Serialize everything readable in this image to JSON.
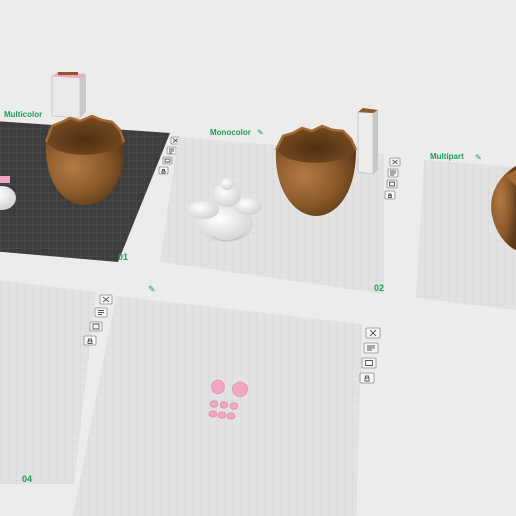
{
  "plates": [
    {
      "label": "Multicolor",
      "edit_icon": "pencil-icon",
      "number": "01",
      "active": true
    },
    {
      "label": "Monocolor",
      "edit_icon": "pencil-icon",
      "number": "02",
      "active": false
    },
    {
      "label": "Multipart",
      "edit_icon": "pencil-icon",
      "number": "",
      "active": false
    },
    {
      "label": "",
      "edit_icon": "",
      "number": "04",
      "active": false
    },
    {
      "label": "",
      "edit_icon": "pencil-icon",
      "number": "",
      "active": false
    }
  ],
  "plate_tools": [
    "close-icon",
    "arrange-icon",
    "settings-icon",
    "lock-icon"
  ],
  "colors": {
    "background": "#ececec",
    "plate": "#e2e2e2",
    "plate_active": "#3b3b3b",
    "grid_line": "#cfcfcf",
    "grid_line_active": "#555555",
    "label": "#1f9d55",
    "egg_brown": "#8b5a2b",
    "figure_white": "#f2f2f2",
    "pink_parts": "#f4a7c4"
  }
}
